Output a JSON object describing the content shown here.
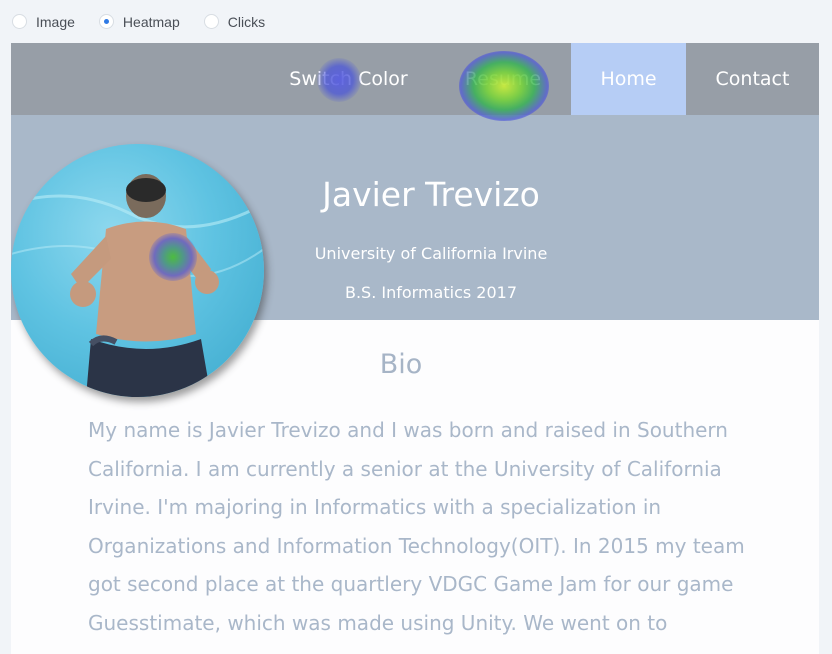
{
  "view_modes": {
    "options": [
      {
        "label": "Image",
        "checked": false
      },
      {
        "label": "Heatmap",
        "checked": true
      },
      {
        "label": "Clicks",
        "checked": false
      }
    ]
  },
  "nav": {
    "switch_color": "Switch Color",
    "resume": "Resume",
    "home": "Home",
    "contact": "Contact"
  },
  "hero": {
    "name": "Javier Trevizo",
    "school": "University of California Irvine",
    "degree": "B.S. Informatics 2017"
  },
  "bio": {
    "title": "Bio",
    "text": "My name is Javier Trevizo and I was born and raised in Southern California. I am currently a senior at the University of California Irvine. I'm majoring in Informatics with a specialization in Organizations and Information Technology(OIT). In 2015 my team got second place at the quartlery VDGC Game Jam for our game Guesstimate, which was made using Unity. We went on to"
  },
  "colors": {
    "navbar": "#979ea7",
    "home_active": "#b6cdf5",
    "hero": "#a9b8c9",
    "bio_text": "#a9b7c9",
    "heat_low": "#4b56d8",
    "heat_mid": "#3bbd3b",
    "heat_high": "#b7e63a"
  }
}
